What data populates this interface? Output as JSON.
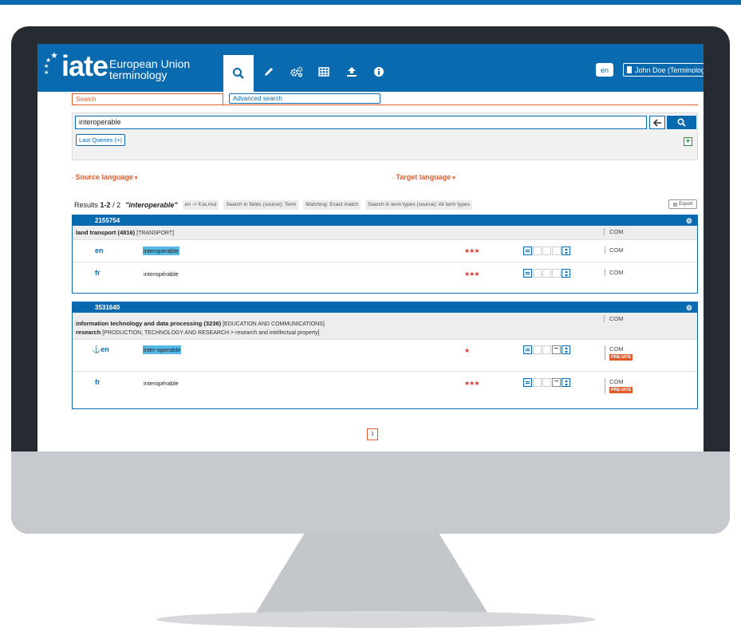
{
  "header": {
    "logo_word": "iate",
    "logo_line1": "European Union",
    "logo_line2": "terminology",
    "nav_icons": [
      "search-icon",
      "pencil-icon",
      "gears-icon",
      "table-icon",
      "upload-icon",
      "info-icon"
    ],
    "language": "en",
    "user": "John Doe (Terminologist)"
  },
  "search": {
    "tab_search": "Search",
    "tab_advanced": "Advanced search",
    "query": "interoperable",
    "last_queries": "Last Queries (+)",
    "source_language": "Source language",
    "target_language": "Target language"
  },
  "results": {
    "label": "Results",
    "range": "1-2",
    "total": "/ 2",
    "query": "\"interoperable\"",
    "chips": [
      "en -> fr,la,mul",
      "Search in fields (source): Term",
      "Matching: Exact match",
      "Search in term types (source): All term types"
    ],
    "export": "Export"
  },
  "entries": [
    {
      "id": "2155754",
      "domain_name": "land transport (4816)",
      "domain_path": "[TRANSPORT]",
      "domain2_name": "",
      "domain2_path": "",
      "domain_com": "COM",
      "terms": [
        {
          "lang": "en",
          "text": "interoperable",
          "stars": "★★★",
          "com": "COM",
          "badge": ""
        },
        {
          "lang": "fr",
          "text": "interopérable",
          "stars": "★★★",
          "com": "COM",
          "badge": ""
        }
      ]
    },
    {
      "id": "3531640",
      "domain_name": "information technology and data processing (3236)",
      "domain_path": "[EDUCATION AND COMMUNICATIONS]",
      "domain2_name": "research",
      "domain2_path": "[PRODUCTION, TECHNOLOGY AND RESEARCH > research and intellectual property]",
      "domain_com": "COM",
      "terms": [
        {
          "lang": "en",
          "text": "inter-operable",
          "stars": "★",
          "com": "COM",
          "badge": "PRE-IATE"
        },
        {
          "lang": "fr",
          "text": "interopérable",
          "stars": "★★★",
          "com": "COM",
          "badge": "PRE-IATE"
        }
      ]
    }
  ],
  "pagination": {
    "page": "1"
  },
  "colors": {
    "brand_blue": "#0a6ab0",
    "accent_orange": "#e05a2a",
    "highlight": "#55b9e8",
    "star_red": "#d9332e"
  }
}
